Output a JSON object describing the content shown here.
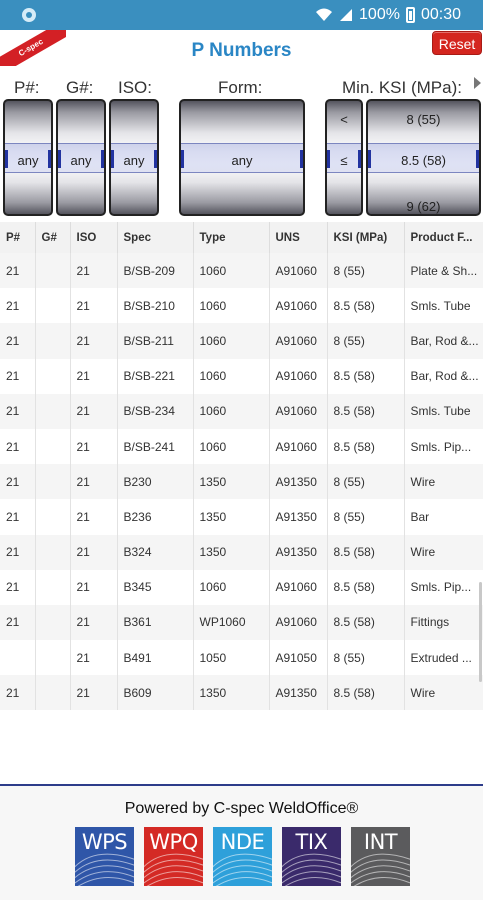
{
  "status_bar": {
    "battery": "100%",
    "time": "00:30"
  },
  "header": {
    "logo_text": "C-spec",
    "title": "P Numbers",
    "reset_label": "Reset"
  },
  "picker_labels": {
    "p": "P#:",
    "g": "G#:",
    "iso": "ISO:",
    "form": "Form:",
    "min_ksi": "Min. KSI (MPa):"
  },
  "pickers": {
    "p": {
      "selected": "any"
    },
    "g": {
      "selected": "any"
    },
    "iso": {
      "selected": "any"
    },
    "form": {
      "selected": "any"
    },
    "operator": {
      "above": "<",
      "selected": "≤"
    },
    "ksi": {
      "above": "8 (55)",
      "selected": "8.5 (58)",
      "below": "9 (62)"
    }
  },
  "table": {
    "columns": [
      "P#",
      "G#",
      "ISO",
      "Spec",
      "Type",
      "UNS",
      "KSI (MPa)",
      "Product F..."
    ],
    "rows": [
      [
        "21",
        "",
        "21",
        "B/SB-209",
        "1060",
        "A91060",
        "8 (55)",
        "Plate & Sh..."
      ],
      [
        "21",
        "",
        "21",
        "B/SB-210",
        "1060",
        "A91060",
        "8.5 (58)",
        "Smls. Tube"
      ],
      [
        "21",
        "",
        "21",
        "B/SB-211",
        "1060",
        "A91060",
        "8 (55)",
        "Bar, Rod &..."
      ],
      [
        "21",
        "",
        "21",
        "B/SB-221",
        "1060",
        "A91060",
        "8.5 (58)",
        "Bar, Rod &..."
      ],
      [
        "21",
        "",
        "21",
        "B/SB-234",
        "1060",
        "A91060",
        "8.5 (58)",
        "Smls. Tube"
      ],
      [
        "21",
        "",
        "21",
        "B/SB-241",
        "1060",
        "A91060",
        "8.5 (58)",
        "Smls. Pip..."
      ],
      [
        "21",
        "",
        "21",
        "B230",
        "1350",
        "A91350",
        "8 (55)",
        "Wire"
      ],
      [
        "21",
        "",
        "21",
        "B236",
        "1350",
        "A91350",
        "8 (55)",
        "Bar"
      ],
      [
        "21",
        "",
        "21",
        "B324",
        "1350",
        "A91350",
        "8.5 (58)",
        "Wire"
      ],
      [
        "21",
        "",
        "21",
        "B345",
        "1060",
        "A91060",
        "8.5 (58)",
        "Smls. Pip..."
      ],
      [
        "21",
        "",
        "21",
        "B361",
        "WP1060",
        "A91060",
        "8.5 (58)",
        "Fittings"
      ],
      [
        "",
        "",
        "21",
        "B491",
        "1050",
        "A91050",
        "8 (55)",
        "Extruded ..."
      ],
      [
        "21",
        "",
        "21",
        "B609",
        "1350",
        "A91350",
        "8.5 (58)",
        "Wire"
      ]
    ]
  },
  "footer": {
    "powered_by": "Powered by C-spec WeldOffice®",
    "products": [
      {
        "label": "WPS",
        "color": "#2f56a8",
        "icon": "wps-logo-icon"
      },
      {
        "label": "WPQ",
        "color": "#d42a25",
        "icon": "wpq-logo-icon"
      },
      {
        "label": "NDE",
        "color": "#2ea0da",
        "icon": "nde-logo-icon"
      },
      {
        "label": "TIX",
        "color": "#3a2a6b",
        "icon": "tix-logo-icon"
      },
      {
        "label": "INT",
        "color": "#5b5b5d",
        "icon": "int-logo-icon"
      }
    ]
  }
}
